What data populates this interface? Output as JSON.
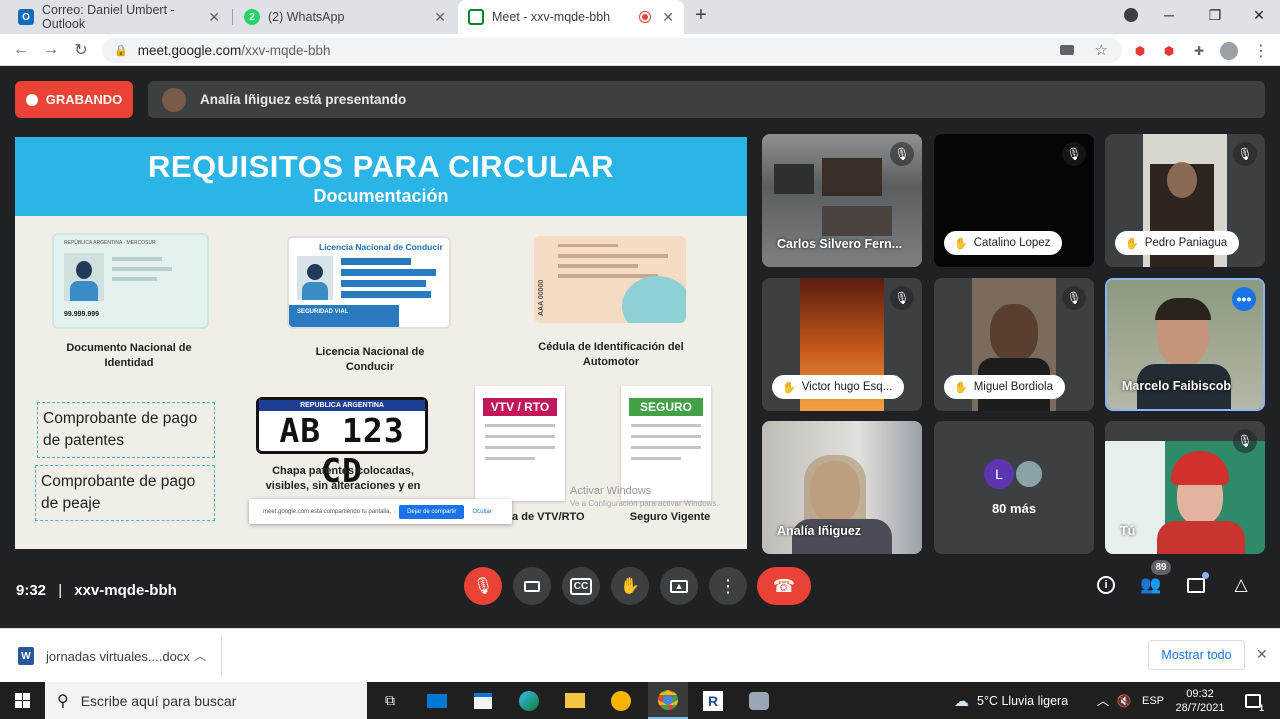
{
  "browser": {
    "tabs": [
      {
        "title": "Correo: Daniel Umbert - Outlook",
        "icon": "outlook-icon",
        "color": "#0f6cbd"
      },
      {
        "title": "(2) WhatsApp",
        "icon": "whatsapp-icon",
        "badge": "2",
        "color": "#25d366"
      },
      {
        "title": "Meet - xxv-mqde-bbh",
        "icon": "meet-icon",
        "color": "#00832d",
        "active": true
      }
    ],
    "url_host": "meet.google.com",
    "url_path": "/xxv-mqde-bbh"
  },
  "meet": {
    "recording_label": "GRABANDO",
    "presenting_text": "Analía Iñiguez está presentando",
    "slide": {
      "title": "REQUISITOS PARA CIRCULAR",
      "subtitle": "Documentación",
      "items": {
        "dni": "Documento Nacional de Identidad",
        "dni_card_header": "REPÚBLICA ARGENTINA - MERCOSUR",
        "dni_number": "99.999.999",
        "license": "Licencia Nacional de Conducir",
        "license_card_header": "Licencia Nacional de Conducir",
        "license_footer": "SEGURIDAD VIAL",
        "cedula": "Cédula de Identificación del Automotor",
        "cedula_plate": "AAA 00000",
        "comprobante_patentes": "Comprobante de pago de patentes",
        "comprobante_peaje": "Comprobante de pago de peaje",
        "plate_header": "REPUBLICA ARGENTINA",
        "plate_number": "AB 123 CD",
        "plate_caption": "Chapa patentes colocadas, visibles, sin alteraciones y en",
        "vtv_header": "VTV / RTO",
        "vtv_caption": "ia de VTV/RTO",
        "seguro_header": "SEGURO",
        "seguro_caption": "Seguro Vigente"
      },
      "watermark_line1": "Activar Windows",
      "watermark_line2": "Ve a Configuración para activar Windows.",
      "share_notice": "meet.google.com está compartiendo tu pantalla.",
      "share_stop": "Dejar de compartir",
      "share_hide": "Ocultar"
    },
    "participants": [
      {
        "name": "Carlos Silvero Fern...",
        "muted": true,
        "hand": false
      },
      {
        "name": "Catalino Lopez",
        "muted": true,
        "hand": true
      },
      {
        "name": "Pedro Paniagua",
        "muted": true,
        "hand": true
      },
      {
        "name": "Victor hugo Esq...",
        "muted": true,
        "hand": true
      },
      {
        "name": "Miguel Bordiola",
        "muted": true,
        "hand": true
      },
      {
        "name": "Marcelo Faibiscob",
        "muted": false,
        "hand": false
      },
      {
        "name": "Analía Iñiguez",
        "muted": false,
        "hand": false
      },
      {
        "name": "80 más",
        "avatar_letter": "L"
      },
      {
        "name": "Tú",
        "muted": true,
        "hand": false
      }
    ],
    "meeting_time": "9:32",
    "meeting_code": "xxv-mqde-bbh",
    "participant_count": "89"
  },
  "download": {
    "filename": "jornadas virtuales....docx",
    "show_all": "Mostrar todo"
  },
  "taskbar": {
    "search_placeholder": "Escribe aquí para buscar",
    "weather": "5°C  Lluvia ligera",
    "lang": "ESP",
    "time": "09:32",
    "date": "28/7/2021",
    "notifications": "1"
  }
}
